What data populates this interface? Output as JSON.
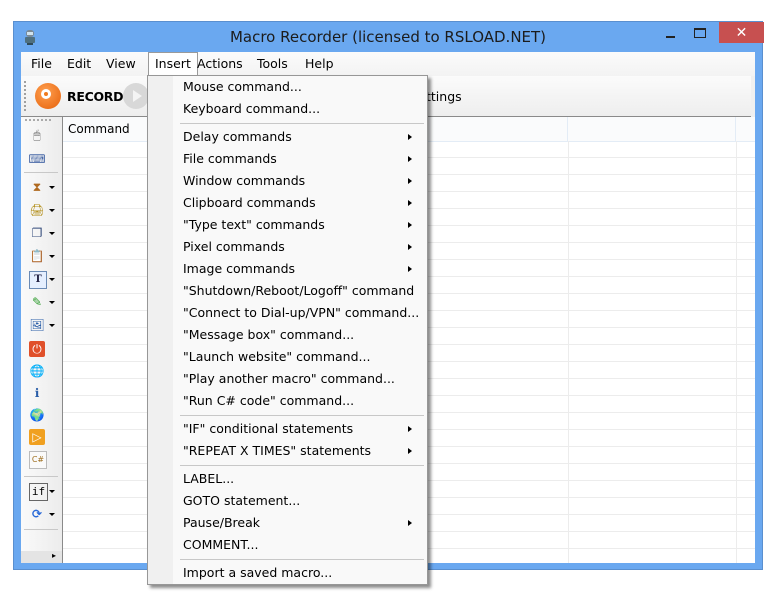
{
  "window": {
    "title": "Macro Recorder (licensed to RSLOAD.NET)",
    "controls": {
      "minimize": "–",
      "maximize": "☐",
      "close": "✕"
    }
  },
  "menubar": {
    "items": [
      {
        "label": "File"
      },
      {
        "label": "Edit"
      },
      {
        "label": "View"
      },
      {
        "label": "Insert",
        "active": true
      },
      {
        "label": "Actions"
      },
      {
        "label": "Tools"
      },
      {
        "label": "Help"
      }
    ]
  },
  "toolbar": {
    "record_label": "RECORD",
    "settings_label_visible": "ttings"
  },
  "sidebar": {
    "icons": [
      {
        "name": "mouse-icon",
        "glyph": "🖱",
        "dropdown": false
      },
      {
        "name": "keyboard-icon",
        "glyph": "⌨",
        "dropdown": false
      },
      {
        "name": "hourglass-icon",
        "glyph": "⧗",
        "dropdown": true
      },
      {
        "name": "printer-file-icon",
        "glyph": "🖨",
        "dropdown": true
      },
      {
        "name": "window-icon",
        "glyph": "❐",
        "dropdown": true
      },
      {
        "name": "clipboard-icon",
        "glyph": "📋",
        "dropdown": true
      },
      {
        "name": "type-text-icon",
        "glyph": "T",
        "dropdown": true
      },
      {
        "name": "pixel-picker-icon",
        "glyph": "✎",
        "dropdown": true
      },
      {
        "name": "image-icon",
        "glyph": "🖼",
        "dropdown": true
      },
      {
        "name": "shutdown-icon",
        "glyph": "⏻",
        "dropdown": false
      },
      {
        "name": "dialup-globe-icon",
        "glyph": "🌐",
        "dropdown": false
      },
      {
        "name": "message-box-icon",
        "glyph": "ℹ",
        "dropdown": false
      },
      {
        "name": "launch-website-icon",
        "glyph": "🌍",
        "dropdown": false
      },
      {
        "name": "play-macro-icon",
        "glyph": "▷",
        "dropdown": false
      },
      {
        "name": "csharp-code-icon",
        "glyph": "C#",
        "dropdown": false
      },
      {
        "name": "if-statement-icon",
        "glyph": "if",
        "dropdown": true
      },
      {
        "name": "repeat-icon",
        "glyph": "⟳",
        "dropdown": true
      }
    ],
    "more_label": "▸"
  },
  "grid": {
    "columns": [
      "Command",
      "",
      ""
    ],
    "rows": []
  },
  "insert_menu": {
    "items": [
      {
        "label": "Mouse command...",
        "submenu": false
      },
      {
        "label": "Keyboard command...",
        "submenu": false
      },
      {
        "separator": true
      },
      {
        "label": "Delay commands",
        "submenu": true
      },
      {
        "label": "File commands",
        "submenu": true
      },
      {
        "label": "Window commands",
        "submenu": true
      },
      {
        "label": "Clipboard commands",
        "submenu": true
      },
      {
        "label": "\"Type text\" commands",
        "submenu": true
      },
      {
        "label": "Pixel commands",
        "submenu": true
      },
      {
        "label": "Image commands",
        "submenu": true
      },
      {
        "label": "\"Shutdown/Reboot/Logoff\" command",
        "submenu": false
      },
      {
        "label": "\"Connect to Dial-up/VPN\" command...",
        "submenu": false
      },
      {
        "label": "\"Message box\" command...",
        "submenu": false
      },
      {
        "label": "\"Launch website\" command...",
        "submenu": false
      },
      {
        "label": "\"Play another macro\" command...",
        "submenu": false
      },
      {
        "label": "\"Run C# code\" command...",
        "submenu": false
      },
      {
        "separator": true
      },
      {
        "label": "\"IF\" conditional statements",
        "submenu": true
      },
      {
        "label": "\"REPEAT X TIMES\" statements",
        "submenu": true
      },
      {
        "separator": true
      },
      {
        "label": "LABEL...",
        "submenu": false
      },
      {
        "label": "GOTO statement...",
        "submenu": false
      },
      {
        "label": "Pause/Break",
        "submenu": true
      },
      {
        "label": "COMMENT...",
        "submenu": false
      },
      {
        "separator": true
      },
      {
        "label": "Import a saved macro...",
        "submenu": false
      }
    ]
  },
  "colors": {
    "window_frame": "#6aa8f0",
    "close_button": "#c75050",
    "record_orange": "#e5600a"
  }
}
